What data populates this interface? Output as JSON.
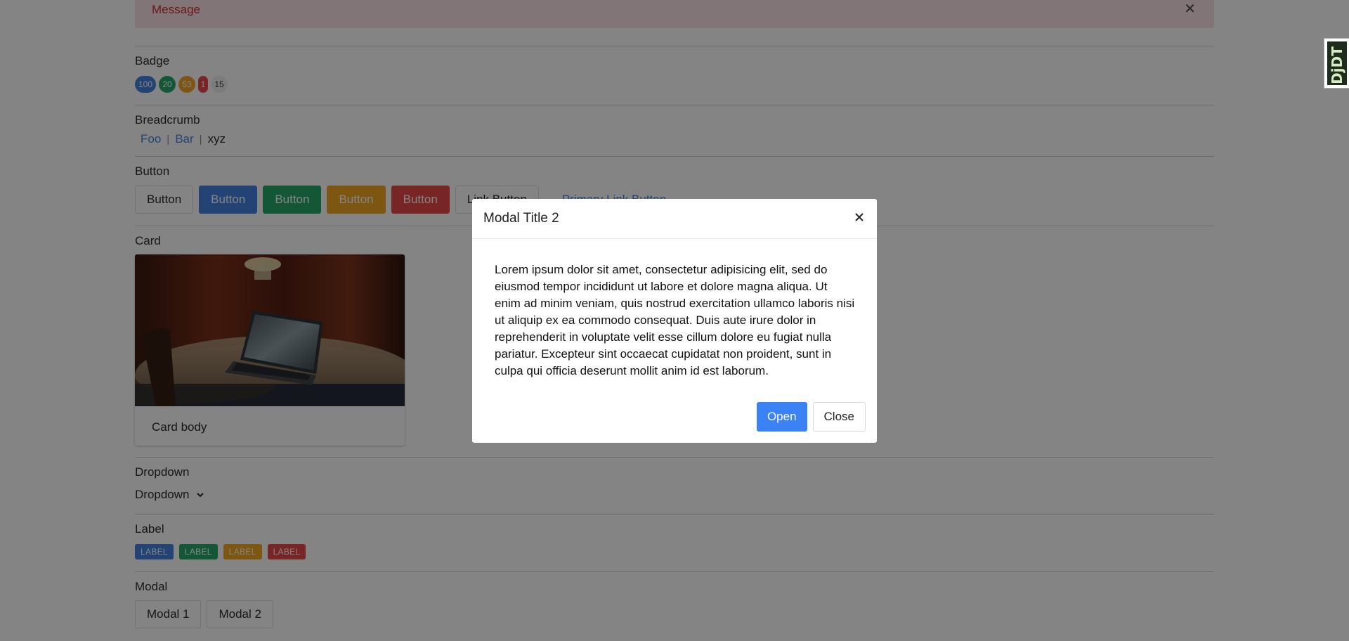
{
  "alert": {
    "message": "Message"
  },
  "sections": {
    "badge": "Badge",
    "breadcrumb": "Breadcrumb",
    "button": "Button",
    "card": "Card",
    "dropdown": "Dropdown",
    "label": "Label",
    "modal": "Modal"
  },
  "badges": [
    "100",
    "20",
    "53",
    "1",
    "15"
  ],
  "breadcrumb": {
    "items": [
      "Foo",
      "Bar"
    ],
    "current": "xyz"
  },
  "buttons": [
    "Button",
    "Button",
    "Button",
    "Button",
    "Button",
    "Link Button",
    "Primary Link Button"
  ],
  "card": {
    "body": "Card body"
  },
  "dropdown": {
    "label": "Dropdown"
  },
  "labels": [
    "LABEL",
    "LABEL",
    "LABEL",
    "LABEL"
  ],
  "modal_buttons": [
    "Modal 1",
    "Modal 2"
  ],
  "modal": {
    "title": "Modal Title 2",
    "body": "Lorem ipsum dolor sit amet, consectetur adipisicing elit, sed do eiusmod tempor incididunt ut labore et dolore magna aliqua. Ut enim ad minim veniam, quis nostrud exercitation ullamco laboris nisi ut aliquip ex ea commodo consequat. Duis aute irure dolor in reprehenderit in voluptate velit esse cillum dolore eu fugiat nulla pariatur. Excepteur sint occaecat cupidatat non proident, sunt in culpa qui officia deserunt mollit anim id est laborum.",
    "open_label": "Open",
    "close_label": "Close"
  },
  "debug_toolbar": {
    "label": "DjDT"
  },
  "colors": {
    "primary": "#3b7ddd",
    "success": "#1fa565",
    "warning": "#f0a21a",
    "danger": "#e64040",
    "alert_bg": "#fbe1e4",
    "modal_primary": "#3b82f6"
  },
  "icons": {
    "alert_close": "close-icon",
    "modal_close": "close-icon",
    "dropdown": "chevron-down-icon"
  }
}
